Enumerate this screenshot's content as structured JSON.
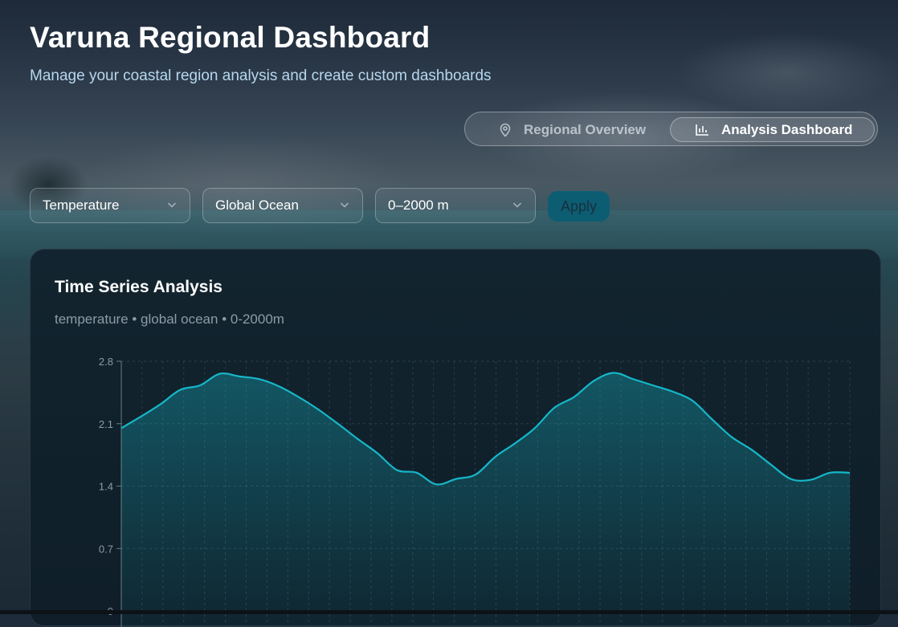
{
  "header": {
    "title": "Varuna Regional Dashboard",
    "subtitle": "Manage your coastal region analysis and create custom dashboards"
  },
  "view_toggle": {
    "tabs": [
      {
        "label": "Regional Overview",
        "icon": "map-pin-icon",
        "active": false
      },
      {
        "label": "Analysis Dashboard",
        "icon": "bar-chart-icon",
        "active": true
      }
    ]
  },
  "filters": {
    "variable": "Temperature",
    "region": "Global Ocean",
    "depth": "0–2000 m",
    "apply_label": "Apply"
  },
  "card": {
    "title": "Time Series Analysis",
    "subtitle": "temperature • global ocean • 0-2000m"
  },
  "colors": {
    "line": "#16b7c8",
    "accent_button": "#0d5d72"
  },
  "chart_data": {
    "type": "area",
    "title": "Time Series Analysis",
    "ylim": [
      0,
      2.8
    ],
    "yticks": [
      "0",
      "0.7",
      "1.4",
      "2.1",
      "2.8"
    ],
    "grid": true,
    "values": [
      2.05,
      2.18,
      2.32,
      2.48,
      2.53,
      2.66,
      2.63,
      2.6,
      2.52,
      2.4,
      2.26,
      2.1,
      1.93,
      1.77,
      1.58,
      1.55,
      1.42,
      1.48,
      1.53,
      1.73,
      1.88,
      2.05,
      2.28,
      2.4,
      2.58,
      2.67,
      2.6,
      2.53,
      2.46,
      2.36,
      2.15,
      1.95,
      1.81,
      1.64,
      1.48,
      1.47,
      1.55,
      1.55
    ]
  }
}
